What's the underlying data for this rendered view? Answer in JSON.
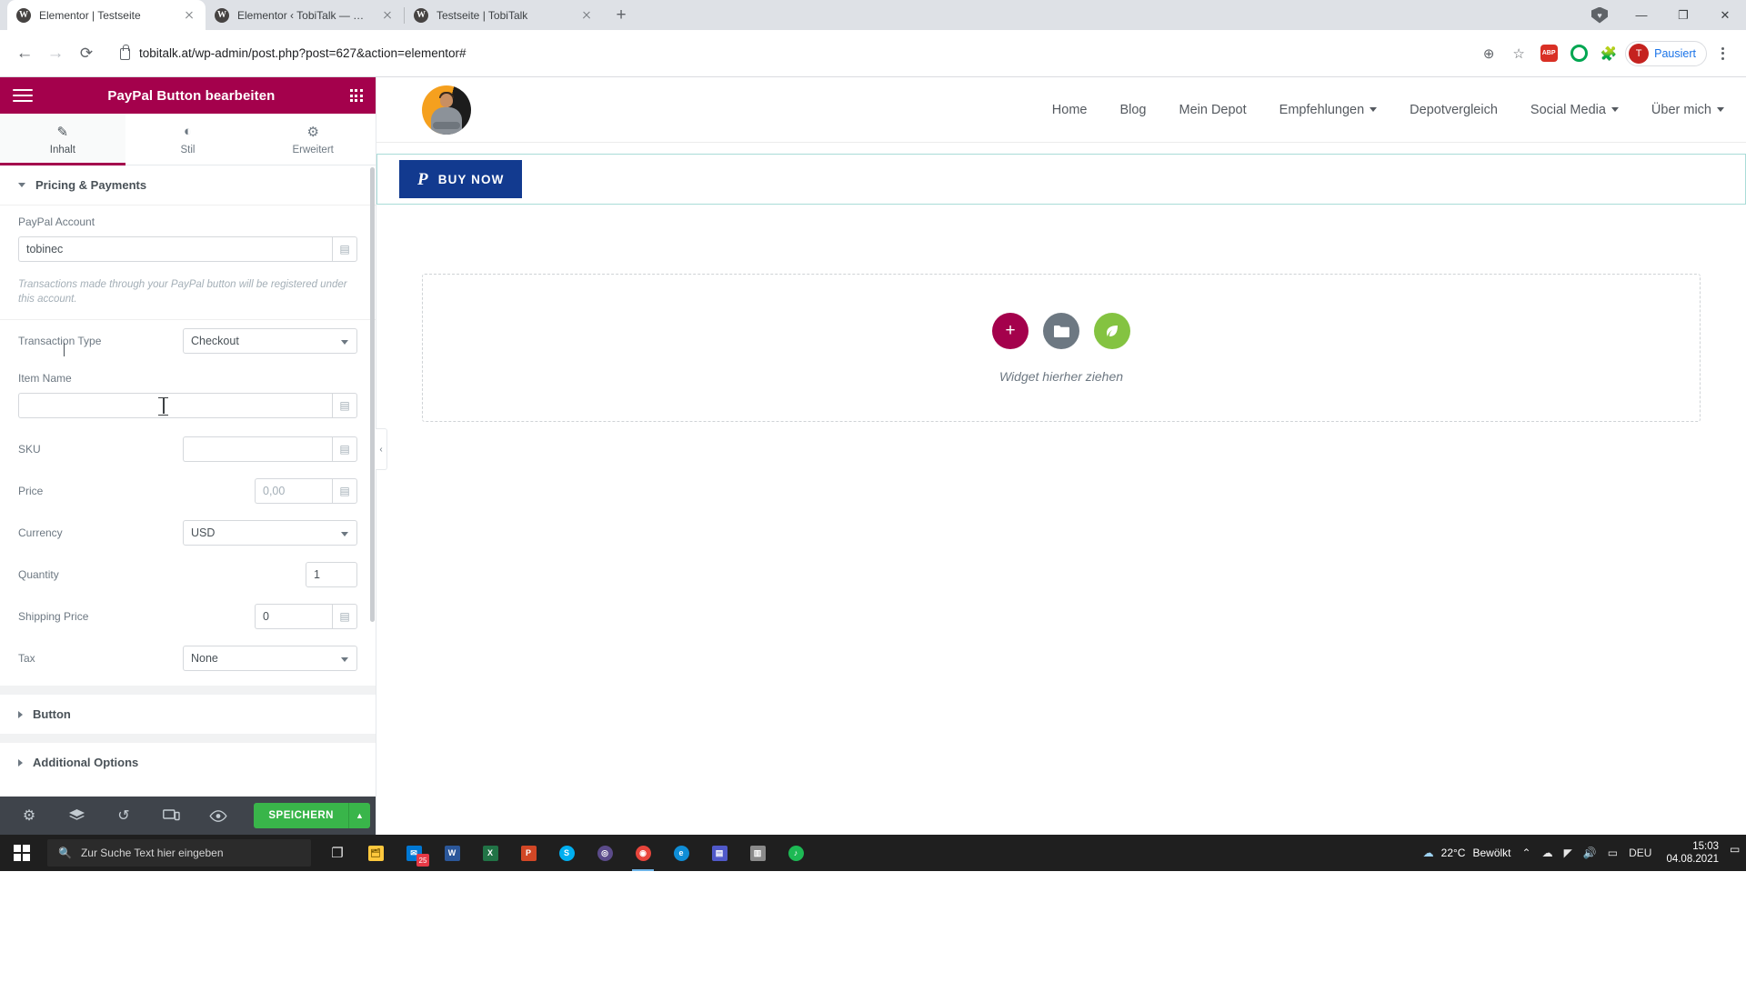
{
  "browser": {
    "tabs": [
      {
        "title": "Elementor | Testseite",
        "active": true
      },
      {
        "title": "Elementor ‹ TobiTalk — WordPre",
        "active": false
      },
      {
        "title": "Testseite | TobiTalk",
        "active": false
      }
    ],
    "newtab_label": "+",
    "url": "tobitalk.at/wp-admin/post.php?post=627&action=elementor#",
    "profile_label": "Pausiert",
    "profile_initial": "T",
    "favicon_letter": "W",
    "window_controls": {
      "minimize": "—",
      "maximize": "❐",
      "close": "✕"
    }
  },
  "panel": {
    "title": "PayPal Button bearbeiten",
    "tabs": [
      {
        "label": "Inhalt",
        "icon": "pencil-icon",
        "glyph": "✎",
        "active": true
      },
      {
        "label": "Stil",
        "icon": "contrast-icon",
        "glyph": "◐",
        "active": false
      },
      {
        "label": "Erweitert",
        "icon": "gear-icon",
        "glyph": "⚙",
        "active": false
      }
    ],
    "sections": {
      "pricing": {
        "title": "Pricing & Payments",
        "expanded": true,
        "paypal_account": {
          "label": "PayPal Account",
          "value": "tobinec",
          "helper": "Transactions made through your PayPal button will be registered under this account."
        },
        "transaction_type": {
          "label": "Transaction Type",
          "value": "Checkout"
        },
        "item_name": {
          "label": "Item Name",
          "value": ""
        },
        "sku": {
          "label": "SKU",
          "value": ""
        },
        "price": {
          "label": "Price",
          "value": "0,00"
        },
        "currency": {
          "label": "Currency",
          "value": "USD"
        },
        "quantity": {
          "label": "Quantity",
          "value": "1"
        },
        "shipping_price": {
          "label": "Shipping Price",
          "value": "0"
        },
        "tax": {
          "label": "Tax",
          "value": "None"
        }
      },
      "button": {
        "title": "Button",
        "expanded": false
      },
      "additional": {
        "title": "Additional Options",
        "expanded": false
      }
    },
    "footer": {
      "settings_icon": "⚙",
      "navigator_icon": "☰",
      "history_icon": "↺",
      "responsive_icon": "▭",
      "preview_icon": "👁",
      "save_label": "SPEICHERN",
      "save_arrow": "▲"
    },
    "collapse_arrow": "‹"
  },
  "preview": {
    "nav": [
      {
        "label": "Home",
        "dropdown": false
      },
      {
        "label": "Blog",
        "dropdown": false
      },
      {
        "label": "Mein Depot",
        "dropdown": false
      },
      {
        "label": "Empfehlungen",
        "dropdown": true
      },
      {
        "label": "Depotvergleich",
        "dropdown": false
      },
      {
        "label": "Social Media",
        "dropdown": true
      },
      {
        "label": "Über mich",
        "dropdown": true
      }
    ],
    "paypal_button": {
      "label": "BUY NOW",
      "logo": "P",
      "color": "#123a8f"
    },
    "dropzone": {
      "text": "Widget hierher ziehen",
      "add_icon": "+",
      "folder_icon": "🗀",
      "leaf_icon": "🍃"
    }
  },
  "taskbar": {
    "search_placeholder": "Zur Suche Text hier eingeben",
    "search_icon": "search-icon",
    "apps": [
      {
        "name": "task-view",
        "glyph": "❏"
      },
      {
        "name": "file-explorer",
        "glyph": "🗂",
        "color": "#ffc83d"
      },
      {
        "name": "mail",
        "glyph": "✉",
        "color": "#0078d4",
        "badge": "25"
      },
      {
        "name": "word",
        "glyph": "W",
        "color": "#2b579a"
      },
      {
        "name": "excel",
        "glyph": "X",
        "color": "#217346"
      },
      {
        "name": "powerpoint",
        "glyph": "P",
        "color": "#d24726"
      },
      {
        "name": "skype",
        "glyph": "S",
        "color": "#00aff0"
      },
      {
        "name": "disc",
        "glyph": "◎",
        "color": "#5b4b8a"
      },
      {
        "name": "chrome",
        "glyph": "◉",
        "color": "#4285f4",
        "active": true
      },
      {
        "name": "edge",
        "glyph": "e",
        "color": "#0078d7"
      },
      {
        "name": "teams",
        "glyph": "▤",
        "color": "#5059c9"
      },
      {
        "name": "photos",
        "glyph": "▥",
        "color": "#8a8a8a"
      },
      {
        "name": "spotify",
        "glyph": "♪",
        "color": "#1db954"
      }
    ],
    "weather": {
      "temp": "22°C",
      "condition": "Bewölkt"
    },
    "tray": {
      "chevron": "⌃",
      "onedrive": "☁",
      "network": "◤",
      "volume": "🔊",
      "battery": "▭",
      "language": "DEU"
    },
    "clock": {
      "time": "15:03",
      "date": "04.08.2021"
    }
  }
}
